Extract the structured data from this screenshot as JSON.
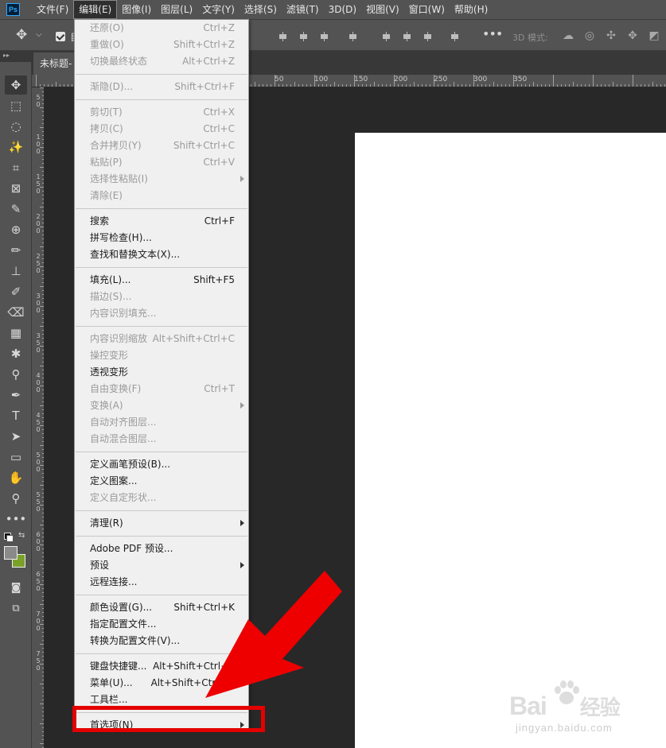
{
  "app": {
    "logo_text": "Ps"
  },
  "menubar": {
    "items": [
      "文件(F)",
      "编辑(E)",
      "图像(I)",
      "图层(L)",
      "文字(Y)",
      "选择(S)",
      "滤镜(T)",
      "3D(D)",
      "视图(V)",
      "窗口(W)",
      "帮助(H)"
    ],
    "active_index": 1
  },
  "options_bar": {
    "partial_text": "自",
    "mode_label": "3D 模式:",
    "icons": [
      "move-icon",
      "chevron-down-icon",
      "align-top-icon",
      "align-vcenter-icon",
      "align-bottom-icon",
      "align-left-icon",
      "align-hcenter-icon",
      "align-right-icon",
      "more-icon",
      "orbit-3d-icon",
      "roll-3d-icon",
      "pan-3d-icon",
      "slide-3d-icon",
      "scale-3d-icon"
    ]
  },
  "document": {
    "tab_title": "未标题-"
  },
  "rulers": {
    "horizontal": [
      "50",
      "100",
      "150",
      "200",
      "250",
      "300",
      "350"
    ],
    "vertical": [
      "50",
      "100",
      "150",
      "200",
      "250",
      "300",
      "350",
      "400",
      "450",
      "500",
      "550",
      "600",
      "650",
      "700",
      "750"
    ]
  },
  "edit_menu": {
    "items": [
      {
        "label": "还原(O)",
        "shortcut": "Ctrl+Z",
        "disabled": true
      },
      {
        "label": "重做(O)",
        "shortcut": "Shift+Ctrl+Z",
        "disabled": true
      },
      {
        "label": "切换最终状态",
        "shortcut": "Alt+Ctrl+Z",
        "disabled": true
      },
      {
        "separator": true
      },
      {
        "label": "渐隐(D)...",
        "shortcut": "Shift+Ctrl+F",
        "disabled": true
      },
      {
        "separator": true
      },
      {
        "label": "剪切(T)",
        "shortcut": "Ctrl+X",
        "disabled": true
      },
      {
        "label": "拷贝(C)",
        "shortcut": "Ctrl+C",
        "disabled": true
      },
      {
        "label": "合并拷贝(Y)",
        "shortcut": "Shift+Ctrl+C",
        "disabled": true
      },
      {
        "label": "粘贴(P)",
        "shortcut": "Ctrl+V",
        "disabled": true
      },
      {
        "label": "选择性粘贴(I)",
        "shortcut": "",
        "disabled": true,
        "submenu": true
      },
      {
        "label": "清除(E)",
        "shortcut": "",
        "disabled": true
      },
      {
        "separator": true
      },
      {
        "label": "搜索",
        "shortcut": "Ctrl+F",
        "disabled": false
      },
      {
        "label": "拼写检查(H)...",
        "shortcut": "",
        "disabled": false
      },
      {
        "label": "查找和替换文本(X)...",
        "shortcut": "",
        "disabled": false
      },
      {
        "separator": true
      },
      {
        "label": "填充(L)...",
        "shortcut": "Shift+F5",
        "disabled": false
      },
      {
        "label": "描边(S)...",
        "shortcut": "",
        "disabled": true
      },
      {
        "label": "内容识别填充...",
        "shortcut": "",
        "disabled": true
      },
      {
        "separator": true
      },
      {
        "label": "内容识别缩放",
        "shortcut": "Alt+Shift+Ctrl+C",
        "disabled": true
      },
      {
        "label": "操控变形",
        "shortcut": "",
        "disabled": true
      },
      {
        "label": "透视变形",
        "shortcut": "",
        "disabled": false
      },
      {
        "label": "自由变换(F)",
        "shortcut": "Ctrl+T",
        "disabled": true
      },
      {
        "label": "变换(A)",
        "shortcut": "",
        "disabled": true,
        "submenu": true
      },
      {
        "label": "自动对齐图层...",
        "shortcut": "",
        "disabled": true
      },
      {
        "label": "自动混合图层...",
        "shortcut": "",
        "disabled": true
      },
      {
        "separator": true
      },
      {
        "label": "定义画笔预设(B)...",
        "shortcut": "",
        "disabled": false
      },
      {
        "label": "定义图案...",
        "shortcut": "",
        "disabled": false
      },
      {
        "label": "定义自定形状...",
        "shortcut": "",
        "disabled": true
      },
      {
        "separator": true
      },
      {
        "label": "清理(R)",
        "shortcut": "",
        "disabled": false,
        "submenu": true
      },
      {
        "separator": true
      },
      {
        "label": "Adobe PDF 预设...",
        "shortcut": "",
        "disabled": false
      },
      {
        "label": "预设",
        "shortcut": "",
        "disabled": false,
        "submenu": true
      },
      {
        "label": "远程连接...",
        "shortcut": "",
        "disabled": false
      },
      {
        "separator": true
      },
      {
        "label": "颜色设置(G)...",
        "shortcut": "Shift+Ctrl+K",
        "disabled": false
      },
      {
        "label": "指定配置文件...",
        "shortcut": "",
        "disabled": false
      },
      {
        "label": "转换为配置文件(V)...",
        "shortcut": "",
        "disabled": false
      },
      {
        "separator": true
      },
      {
        "label": "键盘快捷键...",
        "shortcut": "Alt+Shift+Ctrl+K",
        "disabled": false
      },
      {
        "label": "菜单(U)...",
        "shortcut": "Alt+Shift+Ctrl+M",
        "disabled": false
      },
      {
        "label": "工具栏...",
        "shortcut": "",
        "disabled": false
      },
      {
        "separator": true
      },
      {
        "label": "首选项(N)",
        "shortcut": "",
        "disabled": false,
        "submenu": true
      }
    ]
  },
  "toolbar": {
    "tools": [
      "move-tool-icon",
      "marquee-tool-icon",
      "lasso-tool-icon",
      "magic-wand-icon",
      "crop-tool-icon",
      "frame-tool-icon",
      "eyedropper-icon",
      "healing-brush-icon",
      "brush-tool-icon",
      "clone-stamp-icon",
      "history-brush-icon",
      "eraser-icon",
      "gradient-icon",
      "blur-tool-icon",
      "dodge-tool-icon",
      "pen-tool-icon",
      "type-tool-icon",
      "path-select-icon",
      "rectangle-tool-icon",
      "hand-tool-icon",
      "zoom-tool-icon",
      "more-tools-icon"
    ]
  },
  "colors": {
    "highlight": "#e50000",
    "foreground": "#8a8a8a",
    "background_swatch": "#7ca12a"
  },
  "watermark": {
    "logo": "Bai",
    "logo_suffix": "经验",
    "url": "jingyan.baidu.com"
  }
}
